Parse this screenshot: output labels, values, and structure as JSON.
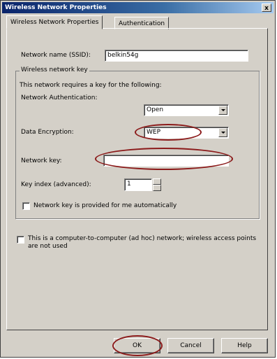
{
  "window": {
    "title": "Wireless Network Properties",
    "close_glyph": "x"
  },
  "tabs": [
    {
      "label": "Wireless Network Properties",
      "active": true
    },
    {
      "label": "Authentication",
      "active": false
    }
  ],
  "form": {
    "ssid_label": "Network name (SSID):",
    "ssid_value": "belkin54g",
    "key_group_label": "Wireless network key",
    "key_note": "This network requires a key for the following:",
    "auth_label": "Network Authentication:",
    "auth_value": "Open",
    "enc_label": "Data Encryption:",
    "enc_value": "WEP",
    "netkey_label": "Network key:",
    "netkey_value": "",
    "keyindex_label": "Key index (advanced):",
    "keyindex_value": "1",
    "auto_key_label": "Network key is provided for me automatically",
    "adhoc_label": "This is a computer-to-computer (ad hoc) network; wireless access points are not used"
  },
  "buttons": {
    "ok": "OK",
    "cancel": "Cancel",
    "help": "Help"
  },
  "colors": {
    "highlight_ellipse": "#8b1a1a",
    "title_bar": "#0a246a"
  }
}
